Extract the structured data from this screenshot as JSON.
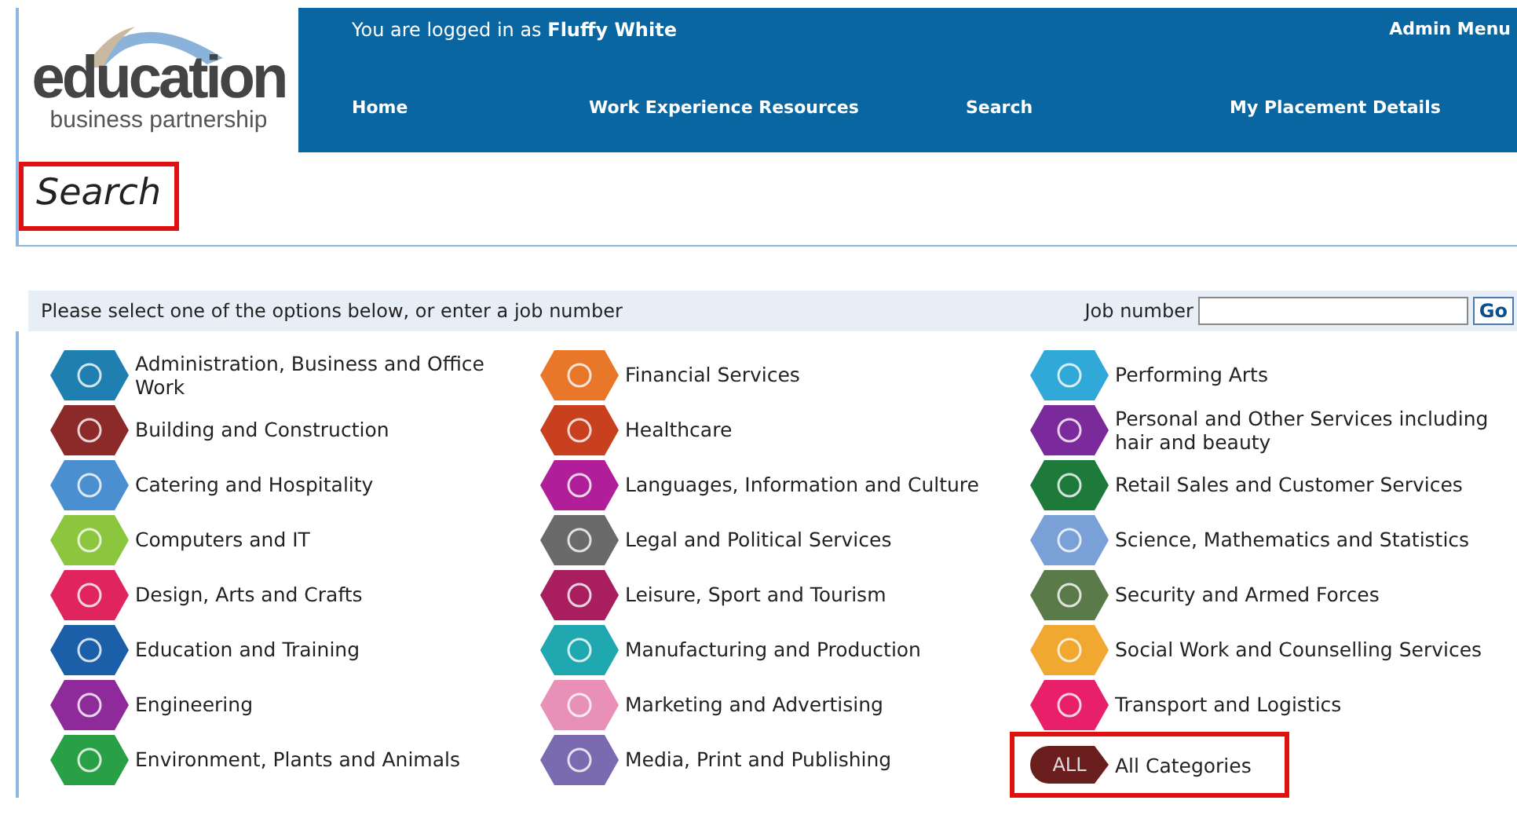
{
  "logo": {
    "title": "education",
    "subtitle": "business partnership"
  },
  "header": {
    "login_prefix": "You are logged in as",
    "user": "Fluffy White",
    "admin_menu": "Admin Menu",
    "nav": [
      {
        "label": "Home"
      },
      {
        "label": "Work Experience Resources"
      },
      {
        "label": "Search"
      },
      {
        "label": "My Placement Details"
      }
    ]
  },
  "page_title": {
    "text": "Search",
    "highlighted": true
  },
  "instruction": "Please select one of the options below, or enter a job number",
  "job_number": {
    "label": "Job number",
    "button": "Go"
  },
  "columns": [
    [
      {
        "label": "Administration, Business and Office Work",
        "color": "#1f7fb0",
        "kind": "icon"
      },
      {
        "label": "Building and Construction",
        "color": "#8c2a2a",
        "kind": "icon"
      },
      {
        "label": "Catering and Hospitality",
        "color": "#4a8fd0",
        "kind": "icon"
      },
      {
        "label": "Computers and IT",
        "color": "#8cc63f",
        "kind": "icon"
      },
      {
        "label": "Design, Arts and Crafts",
        "color": "#e0245e",
        "kind": "icon"
      },
      {
        "label": "Education and Training",
        "color": "#1b5fa8",
        "kind": "icon"
      },
      {
        "label": "Engineering",
        "color": "#8e2a9a",
        "kind": "icon"
      },
      {
        "label": "Environment, Plants and Animals",
        "color": "#2aa046",
        "kind": "icon"
      }
    ],
    [
      {
        "label": "Financial Services",
        "color": "#e8772a",
        "kind": "icon"
      },
      {
        "label": "Healthcare",
        "color": "#c8401e",
        "kind": "icon"
      },
      {
        "label": "Languages, Information and Culture",
        "color": "#b01e9a",
        "kind": "icon"
      },
      {
        "label": "Legal and Political Services",
        "color": "#6a6a6a",
        "kind": "icon"
      },
      {
        "label": "Leisure, Sport and Tourism",
        "color": "#a81e5e",
        "kind": "icon"
      },
      {
        "label": "Manufacturing and Production",
        "color": "#20a8b0",
        "kind": "icon"
      },
      {
        "label": "Marketing and Advertising",
        "color": "#e890b8",
        "kind": "icon"
      },
      {
        "label": "Media, Print and Publishing",
        "color": "#7a6ab0",
        "kind": "icon"
      }
    ],
    [
      {
        "label": "Performing Arts",
        "color": "#30a8d8",
        "kind": "icon"
      },
      {
        "label": "Personal and Other Services including hair and beauty",
        "color": "#7a2a9a",
        "kind": "icon"
      },
      {
        "label": "Retail Sales and Customer Services",
        "color": "#1e7a3a",
        "kind": "icon"
      },
      {
        "label": "Science, Mathematics and Statistics",
        "color": "#7aa0d8",
        "kind": "icon"
      },
      {
        "label": "Security and Armed Forces",
        "color": "#5a7a4a",
        "kind": "icon"
      },
      {
        "label": "Social Work and Counselling Services",
        "color": "#f0a830",
        "kind": "icon"
      },
      {
        "label": "Transport and Logistics",
        "color": "#e8206a",
        "kind": "icon"
      },
      {
        "label": "All Categories",
        "color": "#6a1e1e",
        "kind": "all",
        "badge": "ALL",
        "highlighted": true
      }
    ]
  ]
}
